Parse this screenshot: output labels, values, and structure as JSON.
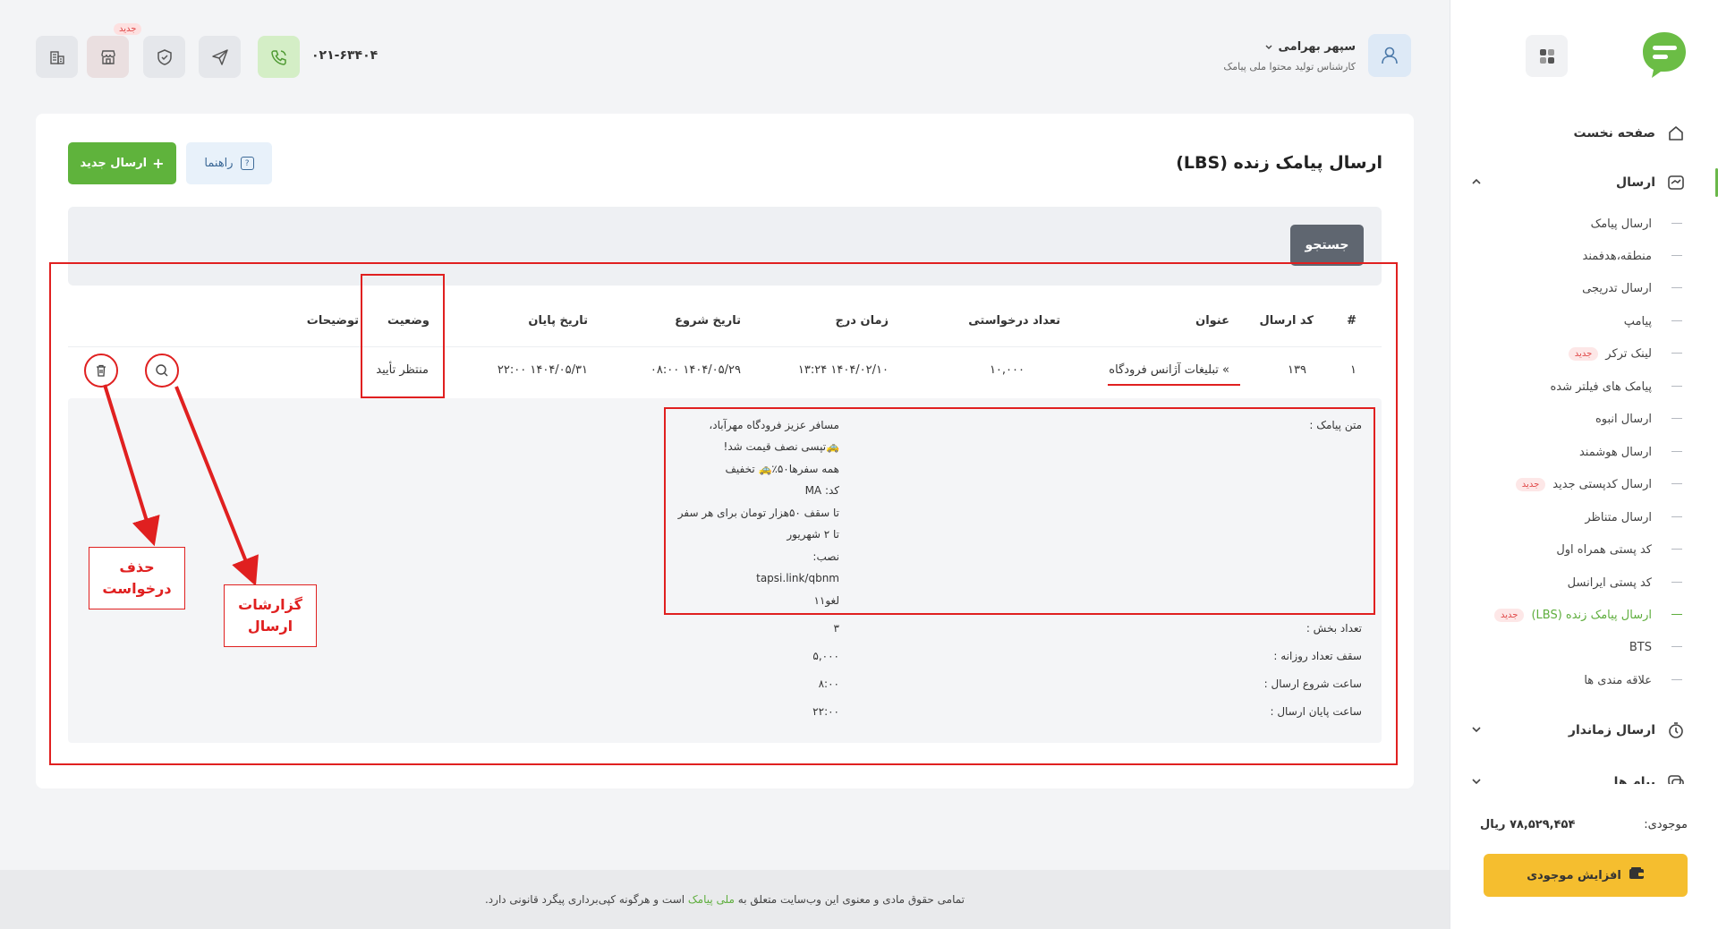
{
  "sidebar": {
    "nav": [
      {
        "label": "صفحه نخست",
        "icon": "home-icon"
      },
      {
        "label": "ارسال",
        "icon": "send-box-icon"
      },
      {
        "label": "ارسال زماندار",
        "icon": "timer-icon"
      },
      {
        "label": "پیام ها",
        "icon": "messages-icon"
      }
    ],
    "sub_items": [
      {
        "label": "ارسال پیامک"
      },
      {
        "label": "منطقه،هدفمند"
      },
      {
        "label": "ارسال تدریجی"
      },
      {
        "label": "پیامپ"
      },
      {
        "label": "لینک ترکر",
        "badge": "جدید"
      },
      {
        "label": "پیامک های فیلتر شده"
      },
      {
        "label": "ارسال انبوه"
      },
      {
        "label": "ارسال هوشمند"
      },
      {
        "label": "ارسال کدپستی جدید",
        "badge": "جدید"
      },
      {
        "label": "ارسال متناظر"
      },
      {
        "label": "کد پستی همراه اول"
      },
      {
        "label": "کد پستی ایرانسل"
      },
      {
        "label": "ارسال پیامک زنده (LBS)",
        "badge": "جدید"
      },
      {
        "label": "BTS"
      },
      {
        "label": "علاقه مندی ها"
      }
    ],
    "balance_label": "موجودی:",
    "balance_value": "۷۸,۵۲۹,۴۵۴ ریال",
    "increase_label": "افزایش موجودی"
  },
  "header": {
    "user_name": "سپهر بهرامی",
    "user_role": "کارشناس تولید محتوا ملی پیامک",
    "phone": "۰۲۱-۶۳۴۰۴",
    "store_badge": "جدید"
  },
  "page": {
    "title": "ارسال پیامک زنده (LBS)",
    "new_send_label": "ارسال جدید",
    "guide_label": "راهنما",
    "search_label": "جستجو"
  },
  "table": {
    "headers": {
      "index": "#",
      "code": "کد ارسال",
      "title": "عنوان",
      "count": "تعداد درخواستی",
      "created": "زمان درج",
      "start": "تاریخ شروع",
      "end": "تاریخ پایان",
      "status": "وضعیت",
      "desc": "توضیحات"
    },
    "row": {
      "index": "۱",
      "code": "۱۳۹",
      "title": "» تبلیغات آژانس فرودگاه",
      "count": "۱۰,۰۰۰",
      "created": "۱۴۰۴/۰۲/۱۰ ۱۳:۲۴",
      "start": "۱۴۰۴/۰۵/۲۹ ۰۸:۰۰",
      "end": "۱۴۰۴/۰۵/۳۱ ۲۲:۰۰",
      "status": "منتظر تأیید"
    }
  },
  "details": {
    "message_label": "متن پیامک :",
    "message_lines": [
      "مسافر عزیز فرودگاه مهرآباد،",
      "🚕تپسی نصف قیمت شد!",
      "همه سفرها۵۰٪🚕 تخفیف",
      "کد: MA",
      "تا سقف ۵۰هزار تومان برای هر سفر",
      "تا ۲ شهریور",
      "نصب:",
      "tapsi.link/qbnm",
      "لغو۱۱"
    ],
    "parts_label": "تعداد بخش :",
    "parts_value": "۳",
    "daily_label": "سقف تعداد روزانه :",
    "daily_value": "۵,۰۰۰",
    "start_time_label": "ساعت شروع ارسال :",
    "start_time_value": "۸:۰۰",
    "end_time_label": "ساعت پایان ارسال :",
    "end_time_value": "۲۲:۰۰"
  },
  "annotations": {
    "delete_label": "حذف درخواست",
    "reports_label": "گزارشات ارسال"
  },
  "footer": {
    "text_before": "تمامی حقوق مادی و معنوی این وب‌سایت متعلق به",
    "brand": "ملی پیامک",
    "text_after": "است و هرگونه کپی‌برداری پیگرد قانونی دارد."
  },
  "colors": {
    "brand_green": "#5fb33c",
    "accent_yellow": "#f5be2f",
    "annotation_red": "#e02020"
  }
}
